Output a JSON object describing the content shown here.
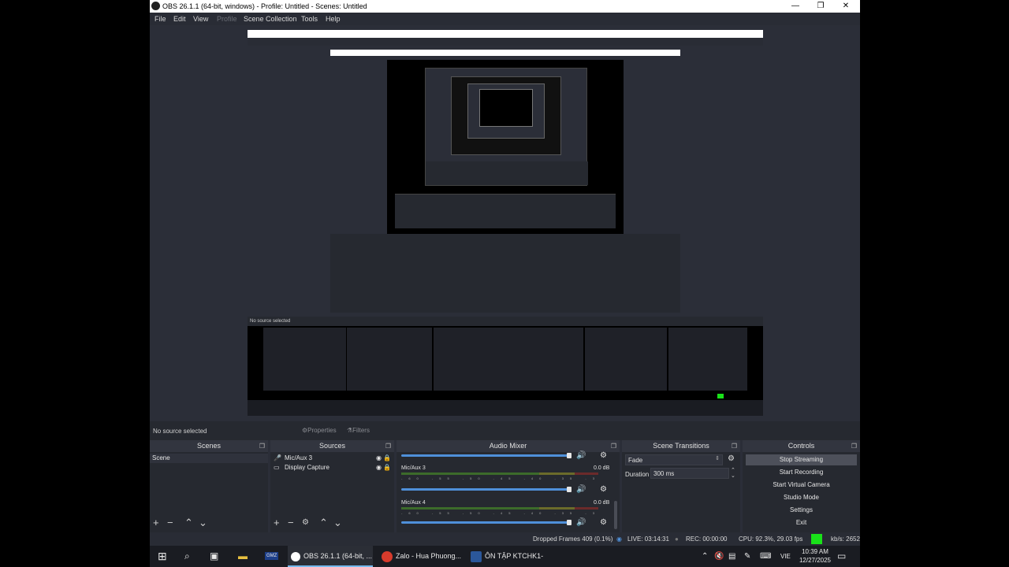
{
  "window": {
    "title": "OBS 26.1.1 (64-bit, windows) - Profile: Untitled - Scenes: Untitled",
    "minimize": "—",
    "maximize": "❐",
    "close": "✕"
  },
  "menu": {
    "file": "File",
    "edit": "Edit",
    "view": "View",
    "profile": "Profile",
    "scene_collection": "Scene Collection",
    "tools": "Tools",
    "help": "Help"
  },
  "source_bar": {
    "no_source": "No source selected",
    "properties": "Properties",
    "filters": "Filters"
  },
  "scenes": {
    "title": "Scenes",
    "items": [
      "Scene"
    ]
  },
  "sources": {
    "title": "Sources",
    "items": [
      "Mic/Aux 3",
      "Display Capture"
    ]
  },
  "mixer": {
    "title": "Audio Mixer",
    "channels": [
      {
        "name": "Mic/Aux 3",
        "db": "0.0 dB",
        "volume": 0.98
      },
      {
        "name": "Mic/Aux 4",
        "db": "0.0 dB",
        "volume": 0.98
      }
    ],
    "ticks": "-60 -55 -50 -45 -40 -35 -30 -25 -20 -15 -10 -5 0"
  },
  "transitions": {
    "title": "Scene Transitions",
    "type": "Fade",
    "duration_label": "Duration",
    "duration": "300 ms"
  },
  "controls": {
    "title": "Controls",
    "buttons": [
      "Stop Streaming",
      "Start Recording",
      "Start Virtual Camera",
      "Studio Mode",
      "Settings",
      "Exit"
    ]
  },
  "status": {
    "dropped": "Dropped Frames 409 (0.1%)",
    "live": "LIVE: 03:14:31",
    "rec": "REC: 00:00:00",
    "cpu": "CPU: 92.3%, 29.03 fps",
    "kbps": "kb/s: 2652"
  },
  "taskbar": {
    "apps": [
      "OBS 26.1.1 (64-bit, ...",
      "Zalo - Hua Phuong...",
      "ÔN TẬP KTCHK1-K..."
    ],
    "lang": "VIE",
    "time": "10:39 AM",
    "date": "12/27/2025",
    "gmz": "GMZ"
  },
  "colors": {
    "accent": "#4f90d9",
    "live_indicator": "#19e119",
    "panel": "#262930"
  }
}
